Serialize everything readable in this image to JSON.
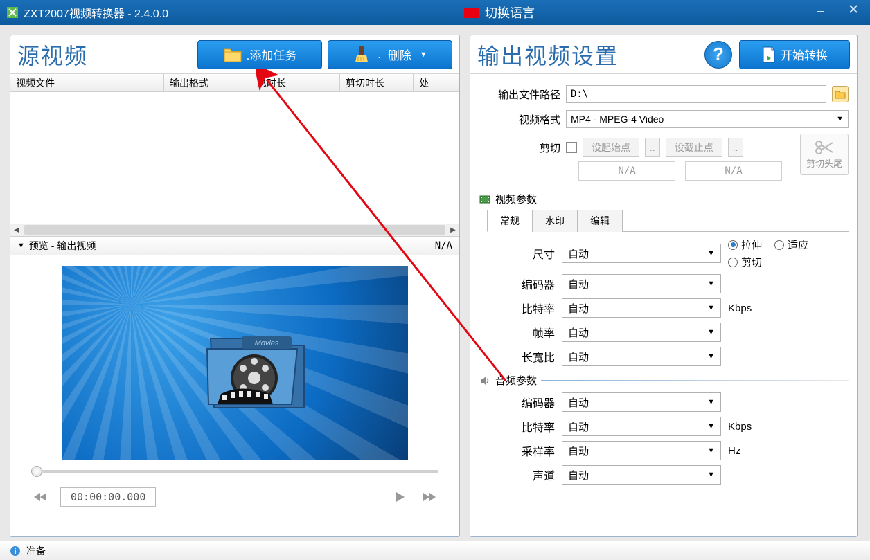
{
  "titlebar": {
    "title": "ZXT2007视频转换器 - 2.4.0.0",
    "lang_switch": "切换语言"
  },
  "left_panel": {
    "title": "源视频",
    "add_task": ".添加任务",
    "delete": "删除",
    "cols": {
      "file": "视频文件",
      "fmt": "输出格式",
      "dur": "总时长",
      "cut": "剪切时长",
      "st": "处"
    },
    "preview_label": "预览 - 输出视频",
    "preview_na": "N/A",
    "timecode": "00:00:00.000"
  },
  "right_panel": {
    "title": "输出视频设置",
    "start_convert": "开始转换",
    "out_path_label": "输出文件路径",
    "out_path_value": "D:\\",
    "video_format_label": "视频格式",
    "video_format_value": "MP4 - MPEG-4 Video",
    "cut_label": "剪切",
    "set_start": "设起始点",
    "set_end": "设截止点",
    "na": "N/A",
    "trim_label": "剪切头尾",
    "video_params": "视频参数",
    "tabs": {
      "general": "常规",
      "watermark": "水印",
      "edit": "编辑"
    },
    "size_label": "尺寸",
    "encoder_label": "编码器",
    "bitrate_label": "比特率",
    "fps_label": "帧率",
    "aspect_label": "长宽比",
    "auto": "自动",
    "kbps": "Kbps",
    "hz": "Hz",
    "stretch": "拉伸",
    "fit": "适应",
    "crop": "剪切",
    "audio_params": "音频参数",
    "sample_label": "采样率",
    "channel_label": "声道"
  },
  "status": {
    "ready": "准备"
  }
}
